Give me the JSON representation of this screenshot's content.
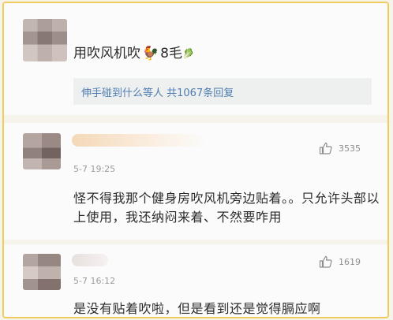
{
  "comments": [
    {
      "text_parts": [
        "用吹风机吹",
        "8毛"
      ],
      "gift_emoji": "🐓",
      "leaf_emoji": "🥬",
      "reply_summary": "伸手碰到什么等人 共1067条回复"
    },
    {
      "time": "5-7 19:25",
      "likes": "3535",
      "text": "怪不得我那个健身房吹风机旁边贴着。。只允许头部以上使用，我还纳闷来着、不然要咋用"
    },
    {
      "time": "5-7 16:12",
      "likes": "1619",
      "text": "是没有贴着吹啦，但是看到还是觉得膈应啊"
    }
  ],
  "icons": {
    "like": "thumbs-up-icon",
    "avatar": "blurred-avatar"
  },
  "colors": {
    "border": "#f0cc5e",
    "reply_text": "#4f7db0",
    "text": "#2b2b2b",
    "meta": "#9c9c9c"
  }
}
